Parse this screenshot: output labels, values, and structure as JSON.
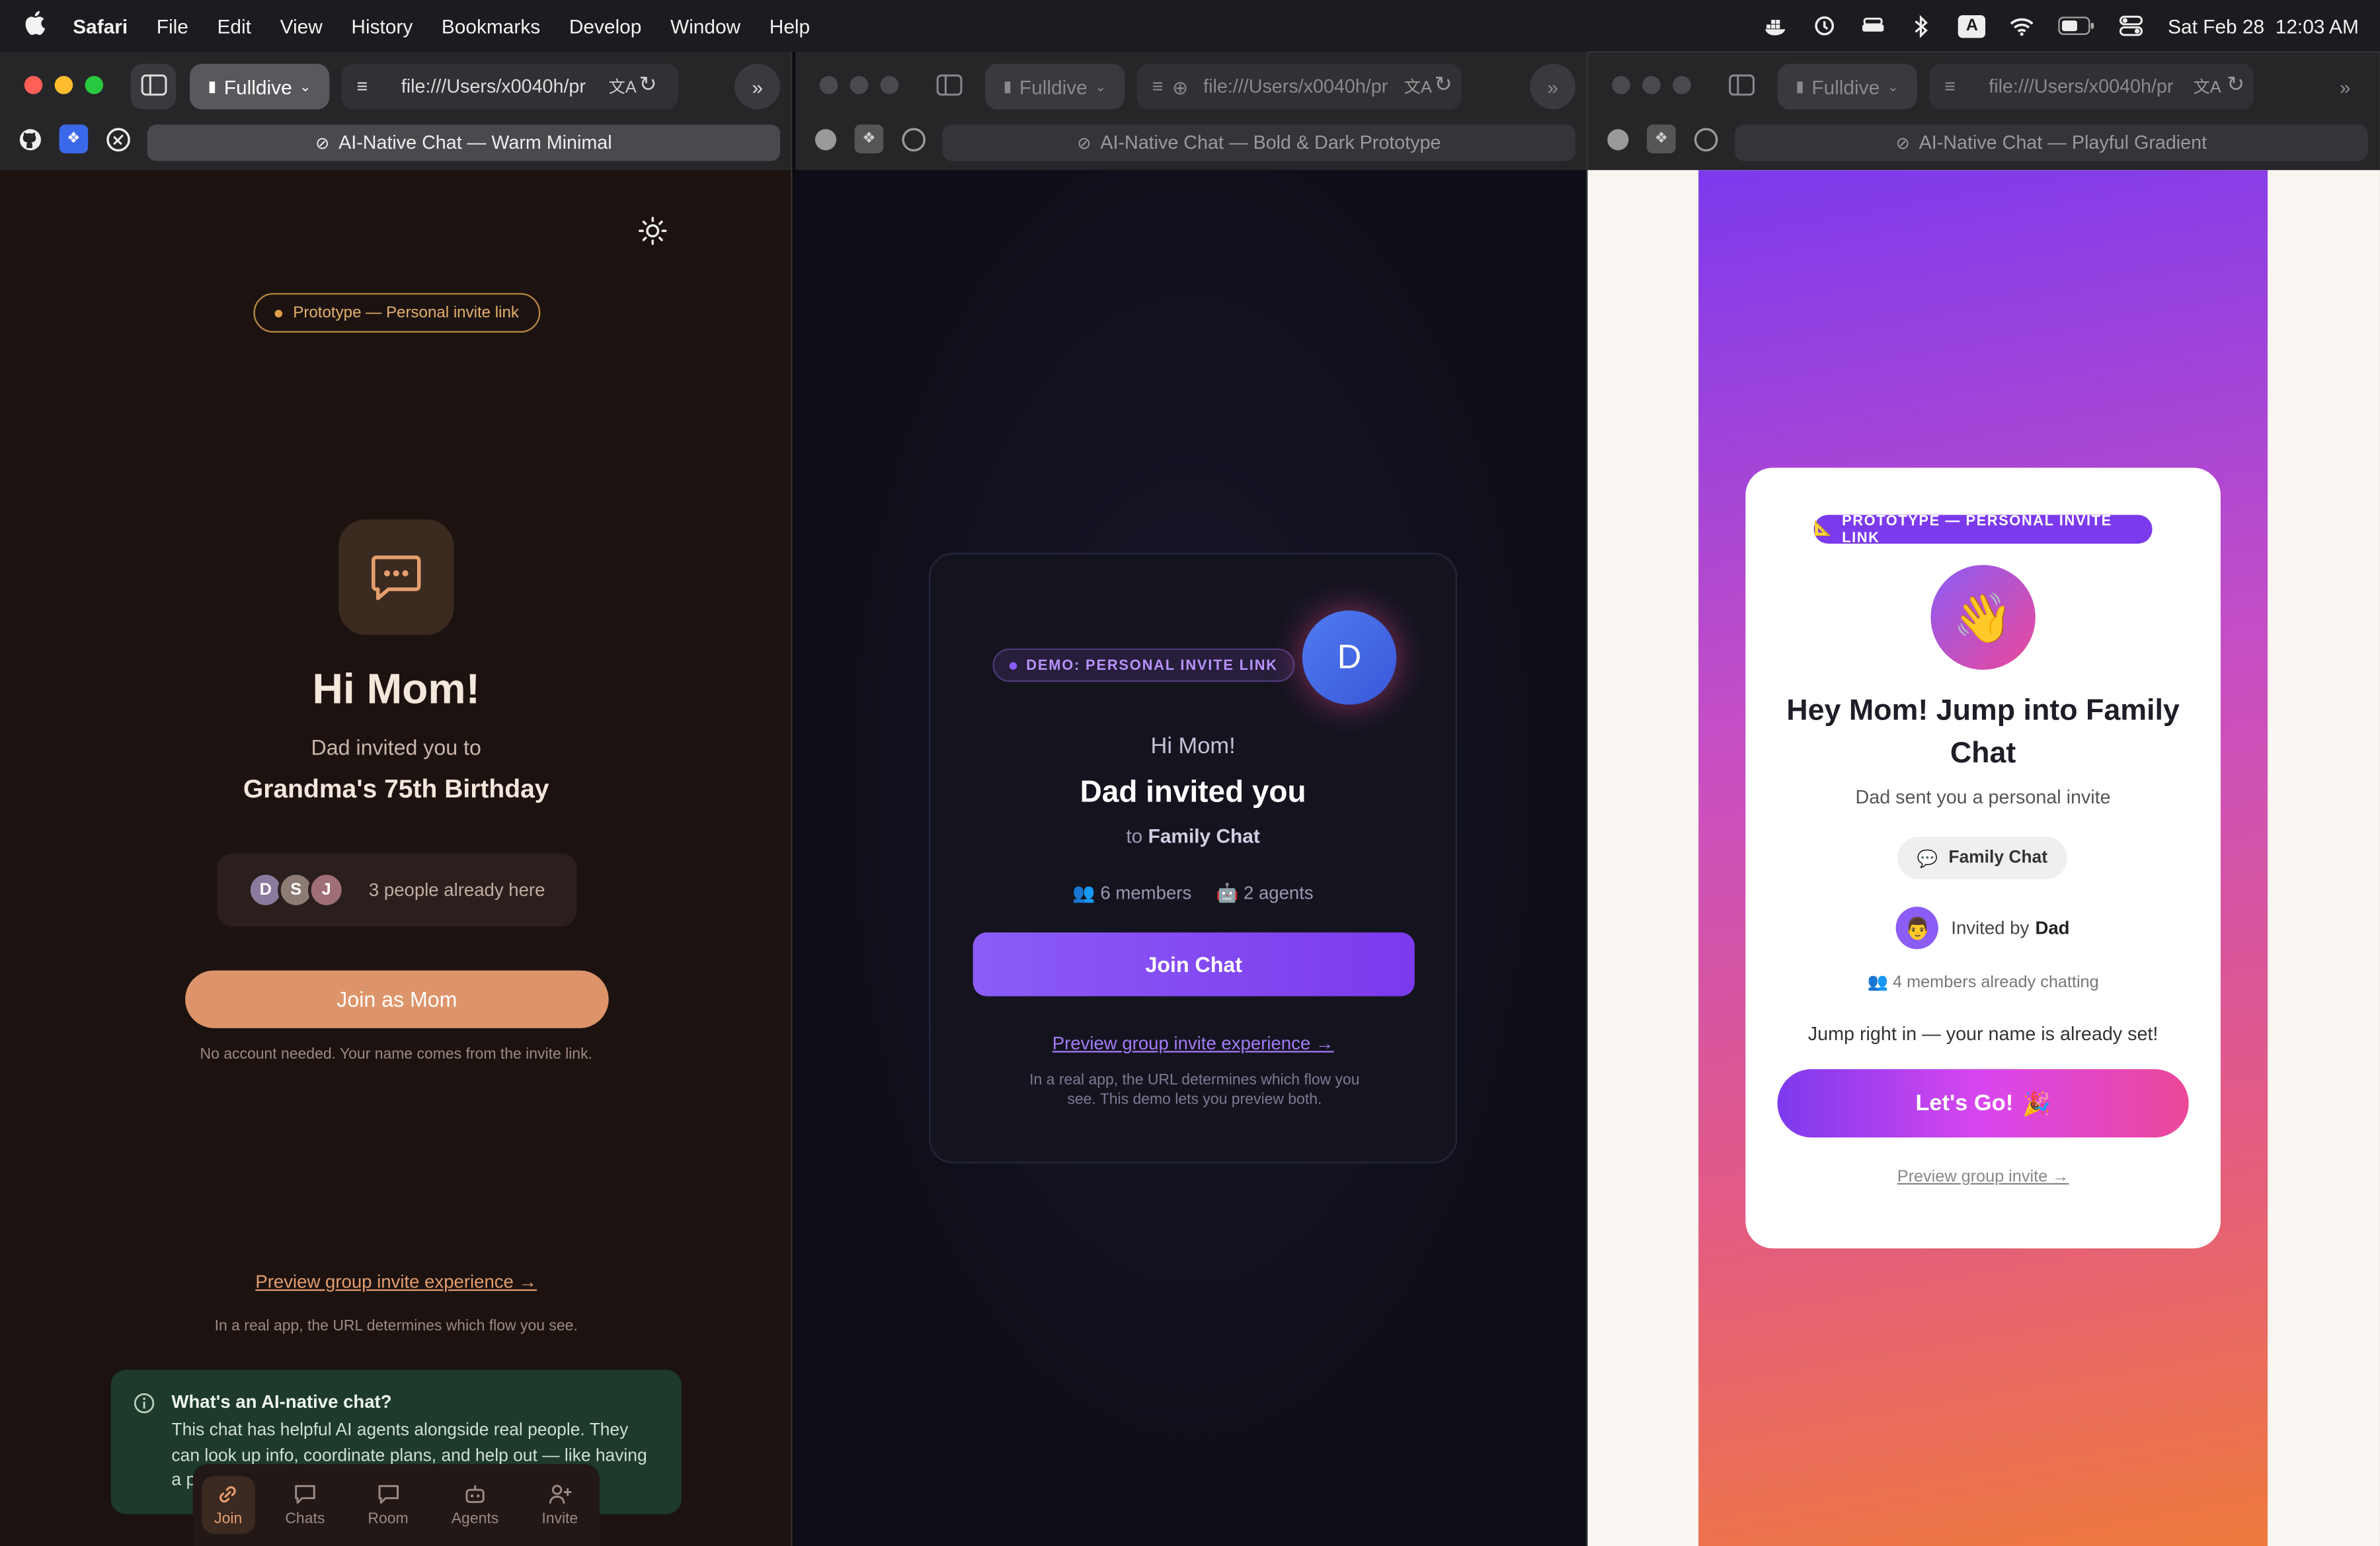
{
  "menubar": {
    "app": "Safari",
    "items": [
      "File",
      "Edit",
      "View",
      "History",
      "Bookmarks",
      "Develop",
      "Window",
      "Help"
    ],
    "clock": "Sat Feb 28  12:03 AM",
    "input_indicator": "A"
  },
  "browser": {
    "profile": "Fulldive",
    "url": "file:///Users/x0040h/pr",
    "windows": [
      {
        "tab_title": "AI-Native Chat — Warm Minimal"
      },
      {
        "tab_title": "AI-Native Chat — Bold & Dark Prototype"
      },
      {
        "tab_title": "AI-Native Chat — Playful Gradient"
      }
    ]
  },
  "warm": {
    "pill": "Prototype — Personal invite link",
    "greeting": "Hi Mom!",
    "invited_by": "Dad invited you to",
    "event": "Grandma's 75th Birthday",
    "avatars": [
      "D",
      "S",
      "J"
    ],
    "people_here": "3 people already here",
    "join_button": "Join as Mom",
    "note": "No account needed. Your name comes from the invite link.",
    "preview_link": "Preview group invite experience →",
    "flow_note": "In a real app, the URL determines which flow you see.",
    "info_title": "What's an AI-native chat?",
    "info_body": "This chat has helpful AI agents alongside real people. They can look up info, coordinate plans, and help out — like having a p",
    "nav": [
      "Join",
      "Chats",
      "Room",
      "Agents",
      "Invite"
    ]
  },
  "dark": {
    "pill": "DEMO: PERSONAL INVITE LINK",
    "avatar": "D",
    "greeting": "Hi Mom!",
    "headline": "Dad invited you",
    "to_prefix": "to",
    "chat_name": "Family Chat",
    "members": "6 members",
    "agents": "2 agents",
    "join_button": "Join Chat",
    "preview_link": "Preview group invite experience →",
    "note": "In a real app, the URL determines which flow you see. This demo lets you preview both."
  },
  "playful": {
    "pill": "PROTOTYPE — PERSONAL INVITE LINK",
    "wave": "👋",
    "headline": "Hey Mom! Jump into Family Chat",
    "subtitle": "Dad sent you a personal invite",
    "chat_chip": "Family Chat",
    "invited_by_prefix": "Invited by",
    "invited_by_name": "Dad",
    "members": "4 members already chatting",
    "tagline": "Jump right in — your name is already set!",
    "cta": "Let's Go!",
    "cta_emoji": "🎉",
    "preview_link": "Preview group invite →"
  },
  "colors": {
    "warm_accent": "#de946a",
    "dark_accent": "#8b5cf6",
    "playful_from": "#7c3aed",
    "playful_to": "#ef7a3c"
  }
}
